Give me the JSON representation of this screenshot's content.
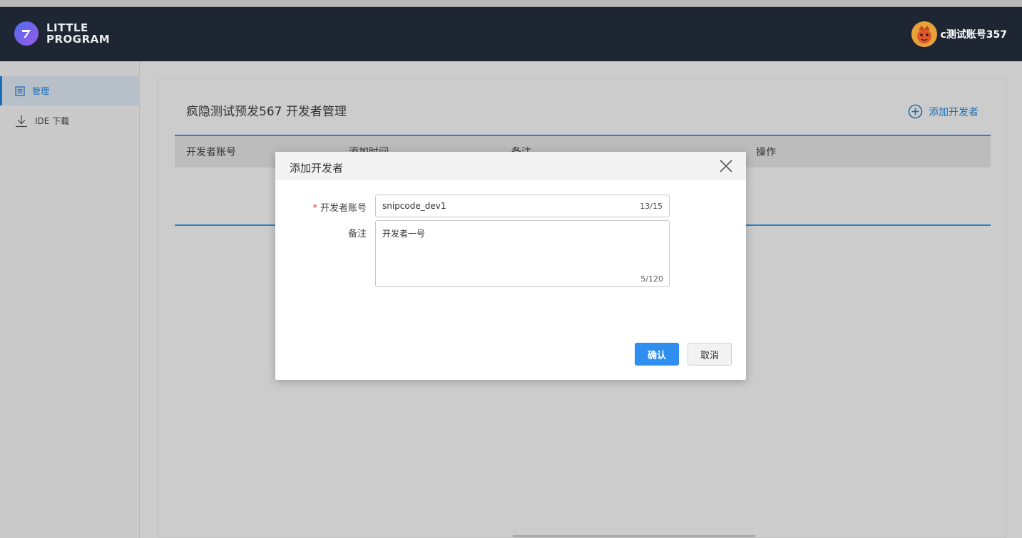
{
  "brand": {
    "line1": "LITTLE",
    "line2": "PROGRAM"
  },
  "user": {
    "name": "c测试账号357"
  },
  "sidebar": {
    "items": [
      {
        "label": "管理",
        "icon": "list-icon",
        "active": true
      },
      {
        "label": "IDE 下载",
        "icon": "download-icon",
        "active": false
      }
    ]
  },
  "page": {
    "title": "疯隐测试预发567 开发者管理",
    "add_label": "添加开发者"
  },
  "table": {
    "columns": [
      "开发者账号",
      "添加时间",
      "备注",
      "操作"
    ]
  },
  "modal": {
    "title": "添加开发者",
    "fields": {
      "account": {
        "label": "开发者账号",
        "required": true,
        "value": "snipcode_dev1",
        "count": "13/15"
      },
      "remark": {
        "label": "备注",
        "value": "开发者一号",
        "count": "5/120"
      }
    },
    "confirm_label": "确认",
    "cancel_label": "取消"
  },
  "colors": {
    "header_bg": "#1e2533",
    "accent": "#1d6fb8",
    "primary_button": "#2f8ff0",
    "required": "#e23c3c"
  }
}
